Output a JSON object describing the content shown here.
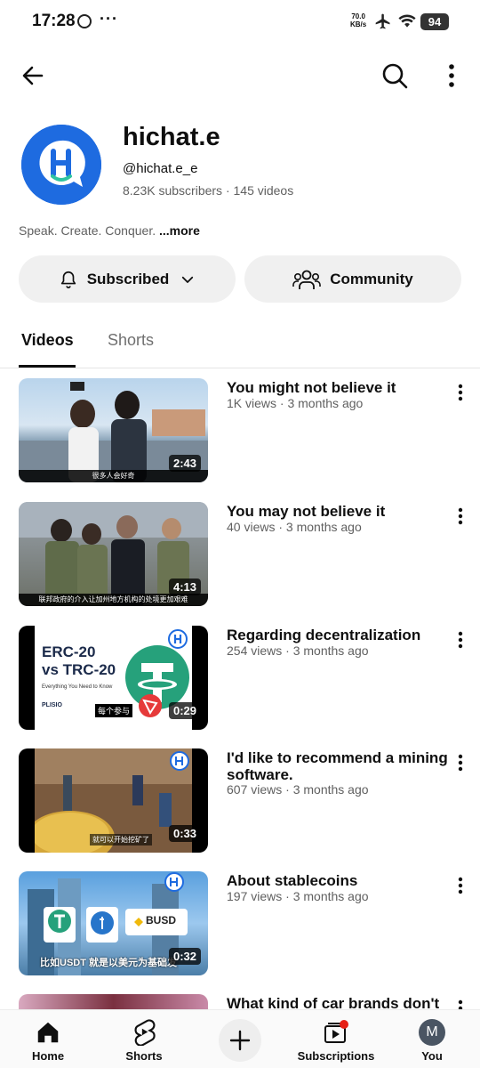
{
  "status_bar": {
    "time": "17:28",
    "speed_value": "70.0",
    "speed_unit": "KB/s",
    "battery": "94"
  },
  "channel": {
    "name": "hichat.e",
    "handle": "@hichat.e_e",
    "stats": "8.23K subscribers · 145 videos",
    "description": "Speak. Create. Conquer.",
    "more_label": "...more",
    "avatar_color": "#1e6be0"
  },
  "actions": {
    "subscribed_label": "Subscribed",
    "community_label": "Community"
  },
  "tabs": {
    "videos": "Videos",
    "shorts": "Shorts"
  },
  "videos": [
    {
      "title": "You might not believe it",
      "meta": "1K views · 3 months ago",
      "duration": "2:43",
      "caption": "很多人会好奇"
    },
    {
      "title": "You may not believe it",
      "meta": "40 views · 3 months ago",
      "duration": "4:13",
      "caption": "联邦政府的介入让加州地方机构的处境更加艰难"
    },
    {
      "title": "Regarding decentralization",
      "meta": "254 views · 3 months ago",
      "duration": "0:29",
      "thumb_line1": "ERC-20",
      "thumb_line2": "vs TRC-20",
      "thumb_sub": "Everything You Need to Know",
      "thumb_brand": "PLISIO",
      "caption": "每个参与"
    },
    {
      "title": "I'd like to recommend a mining software.",
      "meta": "607 views · 3 months ago",
      "duration": "0:33",
      "caption": "就可以开始挖矿了"
    },
    {
      "title": "About stablecoins",
      "meta": "197 views · 3 months ago",
      "duration": "0:32",
      "thumb_brand": "BUSD",
      "caption": "比如USDT 就是以美元为基础发"
    },
    {
      "title": "What kind of car brands don't"
    }
  ],
  "bottom_nav": {
    "home": "Home",
    "shorts": "Shorts",
    "subscriptions": "Subscriptions",
    "you": "You",
    "you_initial": "M"
  }
}
